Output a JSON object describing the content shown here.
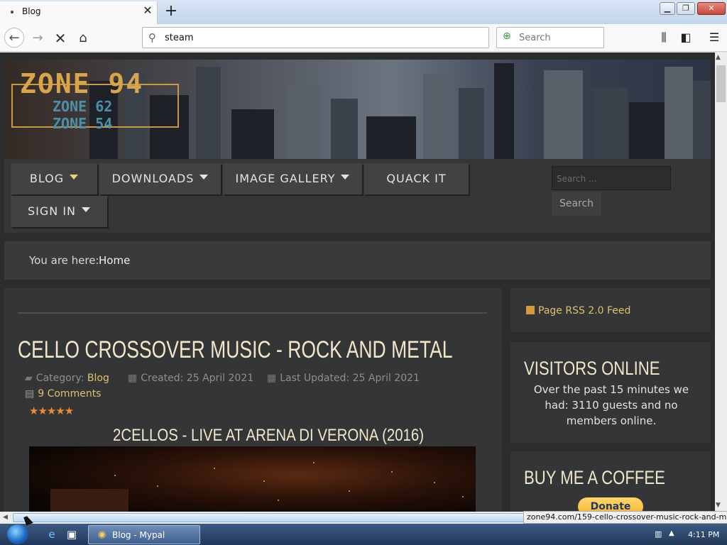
{
  "browser": {
    "tab_title": "Blog",
    "tab_close": "✕",
    "new_tab": "+",
    "url": "steam",
    "search_placeholder": "Search",
    "status_url": "zone94.com/159-cello-crossover-music-rock-and-metal",
    "icons": {
      "back": "back-arrow-icon",
      "forward": "forward-arrow-icon",
      "stop": "stop-icon",
      "home": "home-icon",
      "library": "library-icon",
      "sidebar": "sidebar-icon",
      "menu": "hamburger-menu-icon"
    }
  },
  "site": {
    "logo_main": "ZONE 94",
    "logo_sub1": "ZONE 62",
    "logo_sub2": "ZONE 54",
    "menu": [
      {
        "label": "BLOG",
        "has_dropdown": true
      },
      {
        "label": "DOWNLOADS",
        "has_dropdown": true
      },
      {
        "label": "IMAGE GALLERY",
        "has_dropdown": true
      },
      {
        "label": "QUACK IT",
        "has_dropdown": false
      },
      {
        "label": "SIGN IN",
        "has_dropdown": true
      }
    ],
    "search_placeholder": "Search ...",
    "search_button": "Search",
    "breadcrumb_label": "You are here:",
    "breadcrumb_home": "Home",
    "accent_color": "#e0c069"
  },
  "article": {
    "title": "CELLO CROSSOVER MUSIC - ROCK AND METAL",
    "category_label": "Category:",
    "category": "Blog",
    "created": "Created: 25 April 2021",
    "updated": "Last Updated: 25 April 2021",
    "comments": "9 Comments",
    "rating": "★★★★★",
    "rating_value": 5,
    "subtitle": "2CELLOS - LIVE AT ARENA DI VERONA (2016)"
  },
  "sidebar": {
    "rss": "Page RSS 2.0 Feed",
    "visitors_title": "VISITORS ONLINE",
    "visitors_text": "Over the past 15 minutes we had: 3110 guests and no members online.",
    "coffee_title": "BUY ME A COFFEE",
    "donate": "Donate"
  },
  "taskbar": {
    "task_label": "Blog - Mypal",
    "clock": "4:11 PM"
  }
}
